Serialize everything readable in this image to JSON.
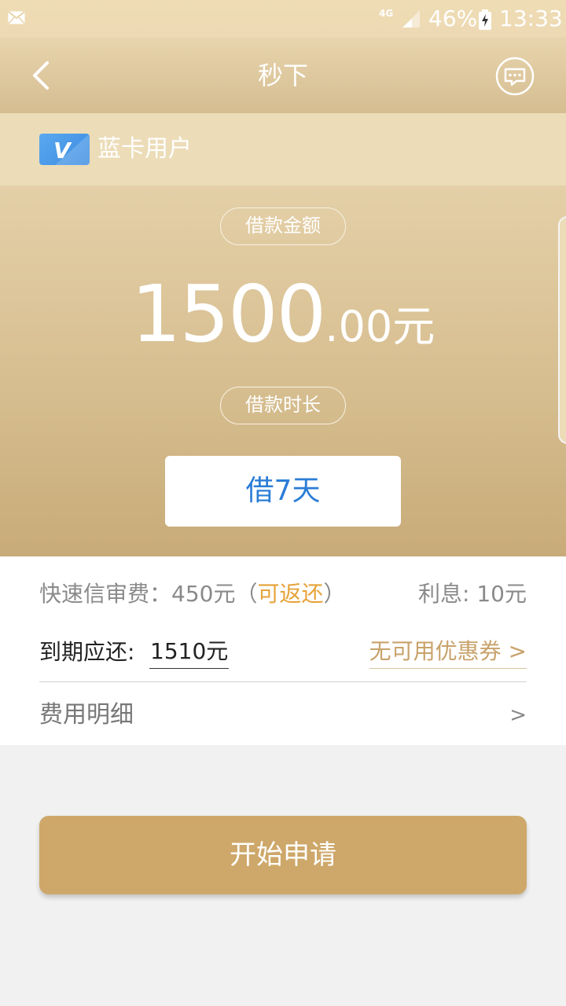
{
  "status_bar": {
    "network": "4G",
    "battery": "46%",
    "time": "13:33",
    "icons": [
      "mail-icon",
      "signal-icon",
      "battery-icon"
    ]
  },
  "header": {
    "title": "秒下",
    "icons": [
      "back-arrow-icon",
      "message-bubble-icon"
    ]
  },
  "user": {
    "badge_letter": "V",
    "type_label": "蓝卡用户"
  },
  "loan": {
    "amount_label": "借款金额",
    "amount_integer": "1500",
    "amount_decimal": ".00",
    "amount_unit": "元",
    "duration_label": "借款时长",
    "duration_value": "借7天"
  },
  "fees": {
    "review_fee_prefix": "快速信审费：450元（",
    "review_fee_refundable": "可返还",
    "review_fee_suffix": "）",
    "interest": "利息: 10元",
    "due_label": "到期应还:",
    "due_amount": "1510元",
    "coupon": "无可用优惠券 >",
    "detail_label": "费用明细",
    "detail_chevron": ">"
  },
  "actions": {
    "apply_label": "开始申请"
  },
  "colors": {
    "gold_primary": "#cea86a",
    "gold_light": "#ecdcb8",
    "accent_orange": "#e6a33a",
    "coupon_gold": "#c8a26a",
    "duration_blue": "#2b7dd6",
    "badge_blue": "#3b8ce0"
  }
}
